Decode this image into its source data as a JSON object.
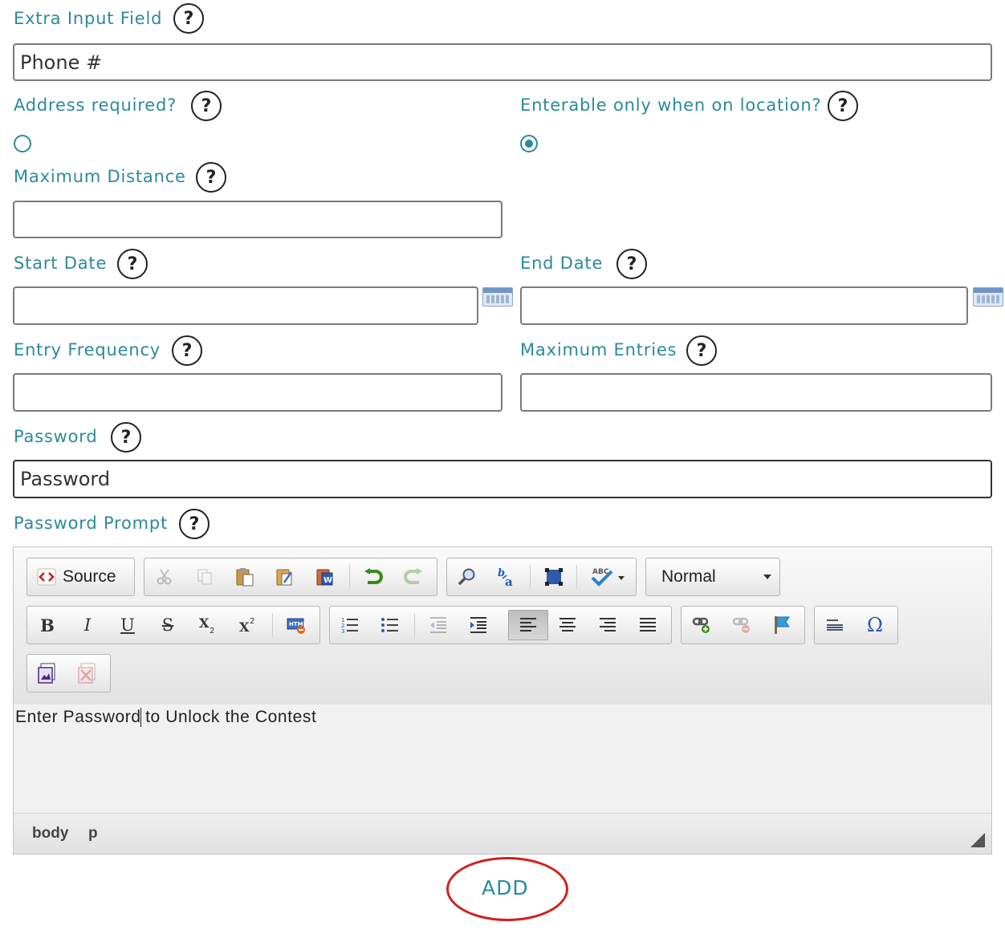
{
  "form": {
    "extra_input": {
      "label": "Extra Input Field",
      "value": "Phone #"
    },
    "address_required": {
      "label": "Address required?",
      "checked": false
    },
    "enterable_on_location": {
      "label": "Enterable only when on location?",
      "checked": true
    },
    "max_distance": {
      "label": "Maximum Distance",
      "value": ""
    },
    "start_date": {
      "label": "Start Date",
      "value": ""
    },
    "end_date": {
      "label": "End Date",
      "value": ""
    },
    "entry_frequency": {
      "label": "Entry Frequency",
      "value": ""
    },
    "max_entries": {
      "label": "Maximum Entries",
      "value": ""
    },
    "password": {
      "label": "Password",
      "placeholder": "Password"
    },
    "password_prompt": {
      "label": "Password Prompt"
    },
    "help_glyph": "?"
  },
  "editor": {
    "source_label": "Source",
    "format_select": "Normal",
    "content_before_caret": "Enter Password",
    "content_after_caret": " to Unlock the Contest",
    "path": [
      "body",
      "p"
    ],
    "icons": {
      "source": "source-icon",
      "cut": "cut-icon",
      "copy": "copy-icon",
      "paste": "paste-icon",
      "paste_text": "paste-text-icon",
      "paste_word": "paste-word-icon",
      "undo": "undo-icon",
      "redo": "redo-icon",
      "find": "find-icon",
      "replace": "replace-icon",
      "select_all": "select-all-icon",
      "spellcheck": "spellcheck-icon",
      "bold": "B",
      "italic": "I",
      "underline": "U",
      "strike": "S",
      "subscript": "X2",
      "superscript": "X2",
      "remove_format": "remove-format-icon",
      "numbered_list": "numbered-list-icon",
      "bulleted_list": "bulleted-list-icon",
      "outdent": "outdent-icon",
      "indent": "indent-icon",
      "align_left": "align-left-icon",
      "align_center": "align-center-icon",
      "align_right": "align-right-icon",
      "justify": "justify-icon",
      "link": "link-icon",
      "unlink": "unlink-icon",
      "anchor": "anchor-icon",
      "horizontal_rule": "horizontal-rule-icon",
      "special_char": "Ω",
      "image": "image-icon",
      "remove_image": "remove-image-icon"
    }
  },
  "actions": {
    "add_label": "ADD"
  },
  "colors": {
    "accent": "#2b8a9a",
    "highlight_ring": "#d0201d"
  }
}
